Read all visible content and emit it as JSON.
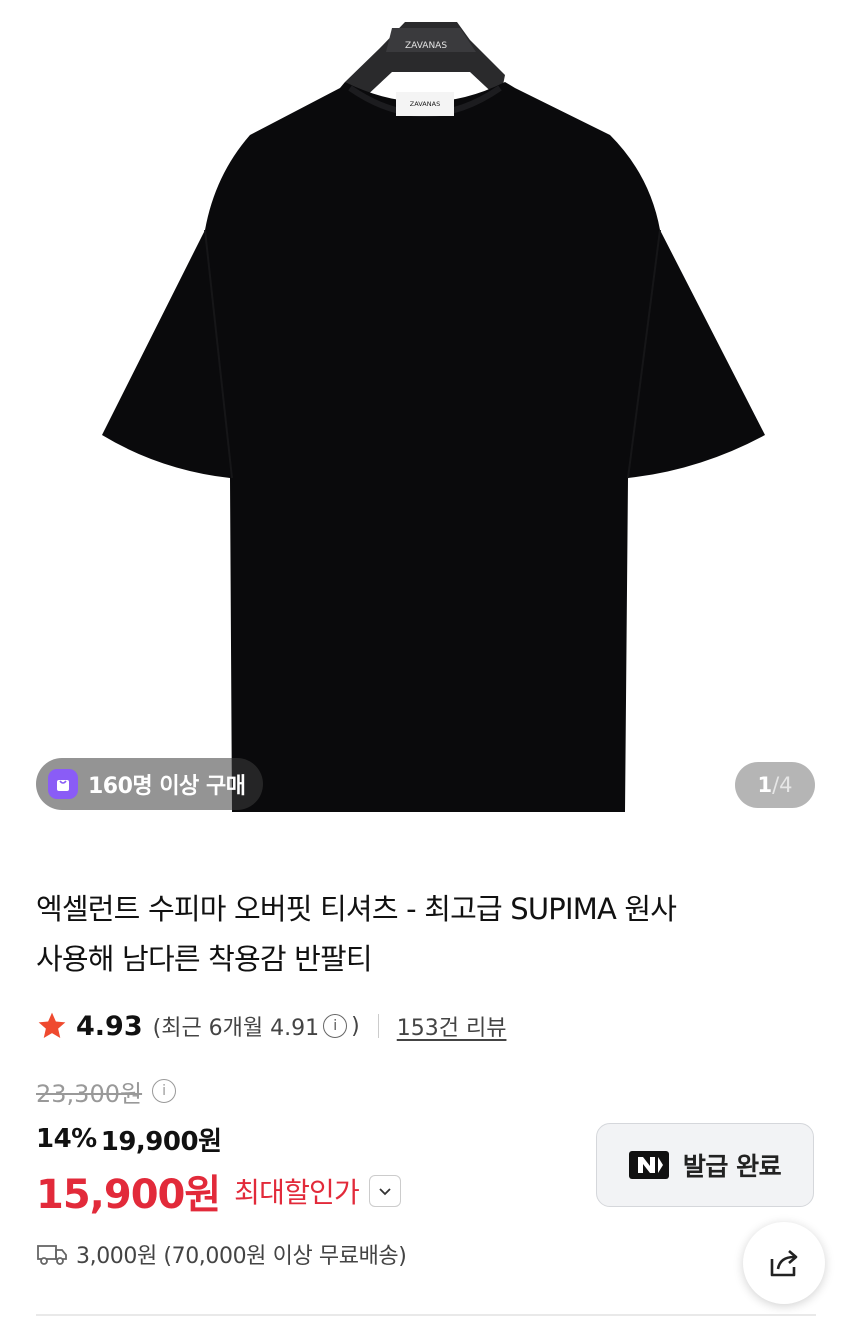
{
  "gallery": {
    "hanger_brand": "ZAVANAS",
    "label_brand": "ZAVANAS",
    "buyers_badge": "160명 이상 구매",
    "page_current": "1",
    "page_separator": "/",
    "page_total": "4"
  },
  "product": {
    "title_line1": "엑셀런트 수피마 오버핏 티셔츠 - 최고급 SUPIMA 원사",
    "title_line2": "사용해 남다른 착용감 반팔티"
  },
  "rating": {
    "value": "4.93",
    "recent": "(최근 6개월 4.91",
    "recent_close": ")",
    "reviews": "153건 리뷰",
    "star_color": "#ef4a2f"
  },
  "price": {
    "original": "23,300원",
    "discount_percent": "14%",
    "sale": "19,900원",
    "max_discount": "15,900원",
    "max_discount_label": "최대할인가",
    "accent_color": "#e22a3a"
  },
  "coupon": {
    "label": "발급 완료",
    "icon": "n-logo-icon"
  },
  "shipping": {
    "text": "3,000원 (70,000원 이상 무료배송)",
    "icon": "truck-icon"
  },
  "share": {
    "icon": "share-icon"
  }
}
